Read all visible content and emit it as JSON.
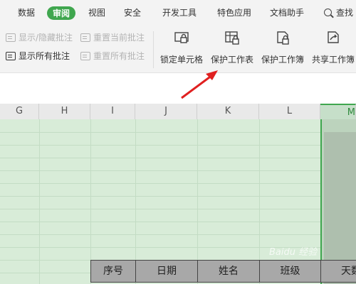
{
  "menu": {
    "tabs": [
      "数据",
      "审阅",
      "视图",
      "安全",
      "开发工具",
      "特色应用",
      "文档助手"
    ],
    "search_label": "查找"
  },
  "ribbon": {
    "small_cmds": [
      "显示/隐藏批注",
      "重置当前批注",
      "显示所有批注",
      "重置所有批注"
    ],
    "big_cmds": [
      "锁定单元格",
      "保护工作表",
      "保护工作簿",
      "共享工作簿"
    ]
  },
  "sheet": {
    "columns": [
      "G",
      "H",
      "I",
      "J",
      "K",
      "L",
      "M"
    ],
    "table_headers": [
      "序号",
      "日期",
      "姓名",
      "班级",
      "天数"
    ]
  },
  "colors": {
    "accent": "#3fa64e",
    "arrow": "#e02020",
    "grid_fill": "#d8ecd8"
  },
  "watermark": "Baidu 经验"
}
